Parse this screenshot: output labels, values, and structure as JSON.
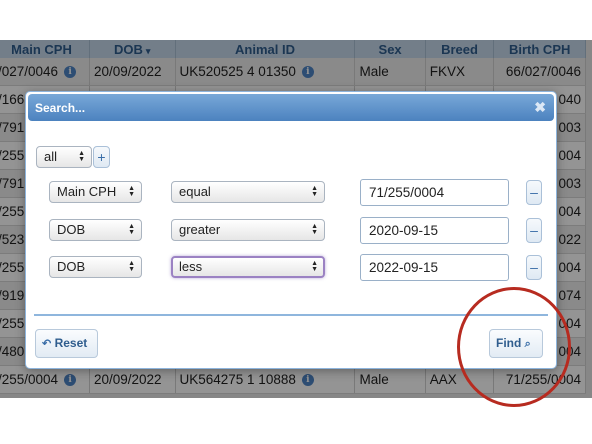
{
  "grid": {
    "columns": [
      {
        "key": "main_cph",
        "label": "Main CPH"
      },
      {
        "key": "dob",
        "label": "DOB"
      },
      {
        "key": "animal_id",
        "label": "Animal ID"
      },
      {
        "key": "sex",
        "label": "Sex"
      },
      {
        "key": "breed",
        "label": "Breed"
      },
      {
        "key": "birth_cph",
        "label": "Birth CPH"
      }
    ],
    "sort_indicator": "▾",
    "rows": [
      {
        "main_cph": "/027/0046",
        "dob": "20/09/2022",
        "animal_id": "UK520525 4 01350",
        "sex": "Male",
        "breed": "FKVX",
        "birth_cph": "66/027/0046"
      },
      {
        "main_cph": "/166",
        "dob": "",
        "animal_id": "",
        "sex": "",
        "breed": "",
        "birth_cph": "040"
      },
      {
        "main_cph": "/791",
        "dob": "",
        "animal_id": "",
        "sex": "",
        "breed": "",
        "birth_cph": "003"
      },
      {
        "main_cph": "/255",
        "dob": "",
        "animal_id": "",
        "sex": "",
        "breed": "",
        "birth_cph": "004"
      },
      {
        "main_cph": "/791",
        "dob": "",
        "animal_id": "",
        "sex": "",
        "breed": "",
        "birth_cph": "003"
      },
      {
        "main_cph": "/255",
        "dob": "",
        "animal_id": "",
        "sex": "",
        "breed": "",
        "birth_cph": "004"
      },
      {
        "main_cph": "/523",
        "dob": "",
        "animal_id": "",
        "sex": "",
        "breed": "",
        "birth_cph": "022"
      },
      {
        "main_cph": "/255",
        "dob": "",
        "animal_id": "",
        "sex": "",
        "breed": "",
        "birth_cph": "004"
      },
      {
        "main_cph": "/919",
        "dob": "",
        "animal_id": "",
        "sex": "",
        "breed": "",
        "birth_cph": "074"
      },
      {
        "main_cph": "/255",
        "dob": "",
        "animal_id": "",
        "sex": "",
        "breed": "",
        "birth_cph": "004"
      },
      {
        "main_cph": "/480",
        "dob": "",
        "animal_id": "",
        "sex": "",
        "breed": "",
        "birth_cph": "004"
      },
      {
        "main_cph": "/255/0004",
        "dob": "20/09/2022",
        "animal_id": "UK564275 1 10888",
        "sex": "Male",
        "breed": "AAX",
        "birth_cph": "71/255/0004"
      }
    ]
  },
  "dialog": {
    "title": "Search...",
    "close_symbol": "✖",
    "match_mode": "all",
    "add_symbol": "+",
    "criteria": [
      {
        "field": "Main CPH",
        "operator": "equal",
        "value": "71/255/0004"
      },
      {
        "field": "DOB",
        "operator": "greater",
        "value": "2020-09-15"
      },
      {
        "field": "DOB",
        "operator": "less",
        "value": "2022-09-15"
      }
    ],
    "remove_symbol": "–",
    "reset_label": "Reset",
    "find_label": "Find"
  },
  "colors": {
    "header_bg": "#c6d9ec",
    "header_text": "#2f5d8e",
    "title_bar": "#5b8fca",
    "focus_ring": "#9b82c3",
    "annotation_circle": "#b72b20"
  },
  "icons": {
    "info": "info-icon",
    "reset": "undo-arrow-icon",
    "find": "magnifier-icon",
    "close": "close-icon"
  }
}
